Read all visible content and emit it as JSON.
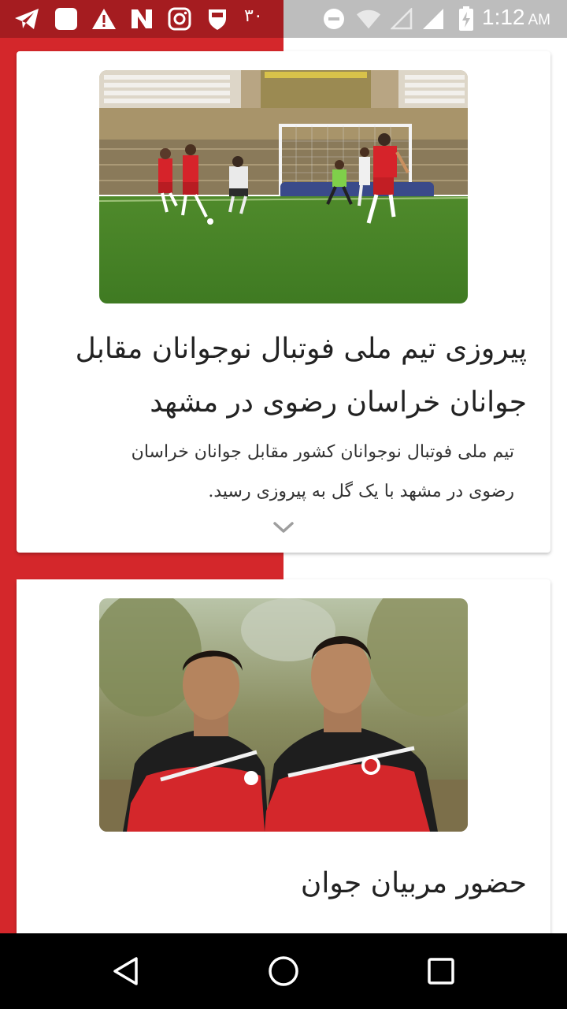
{
  "status_bar": {
    "notification_icons": [
      "telegram-icon",
      "message-icon",
      "warning-icon",
      "n-app-icon",
      "instagram-icon",
      "shield-icon"
    ],
    "notification_count": "۳۰",
    "system_icons": [
      "dnd-icon",
      "wifi-icon",
      "signal-empty-icon",
      "signal-icon",
      "battery-charging-icon"
    ],
    "time": "1:12",
    "ampm": "AM"
  },
  "colors": {
    "accent": "#d4272b",
    "status_bar_left": "#a51c20",
    "status_bar_right": "#bdbdbd"
  },
  "feed": {
    "items": [
      {
        "title": "پیروزی تیم ملی فوتبال نوجوانان مقابل جوانان خراسان رضوی در مشهد",
        "summary": "تیم ملی فوتبال نوجوانان کشور مقابل جوانان خراسان رضوی در مشهد با یک گل به پیروزی رسید.",
        "image": "football-match-photo",
        "expand_icon": "chevron-down-icon"
      },
      {
        "title": "حضور مربیان جوان",
        "image": "two-players-photo"
      }
    ]
  },
  "nav_bar": {
    "buttons": [
      "back-icon",
      "home-icon",
      "recents-icon"
    ]
  }
}
